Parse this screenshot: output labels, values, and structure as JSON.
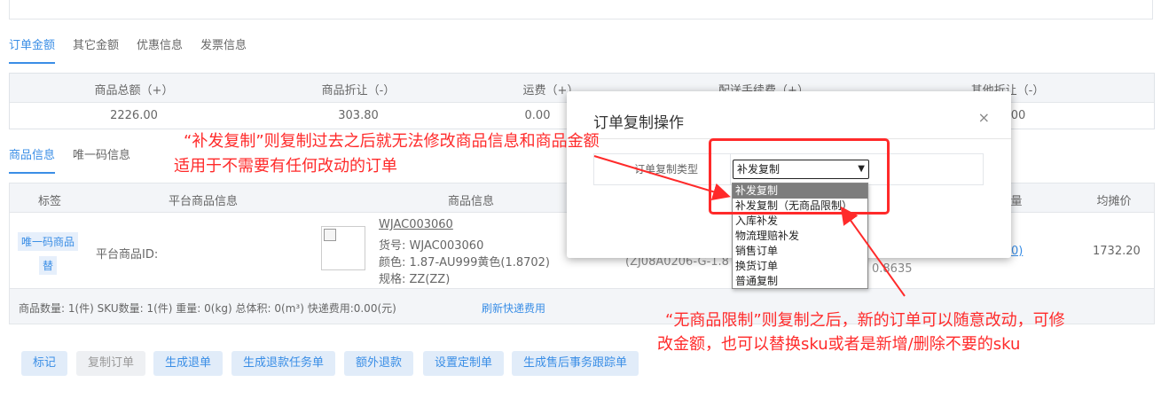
{
  "tabs_amount": [
    "订单金额",
    "其它金额",
    "优惠信息",
    "发票信息"
  ],
  "summary": {
    "headers": [
      "商品总额（+）",
      "商品折让（-）",
      "运费（+）",
      "配送手续费（+）",
      "其他折让（-）"
    ],
    "values": [
      "2226.00",
      "303.80",
      "0.00",
      "",
      ".00"
    ]
  },
  "tabs_goods": [
    "商品信息",
    "唯一码信息"
  ],
  "goods_table": {
    "headers": [
      "标签",
      "平台商品信息",
      "商品信息",
      "量",
      "均摊价"
    ],
    "row": {
      "tag1": "唯一码商品",
      "tag2": "替",
      "platform_id_label": "平台商品ID:",
      "sku_link": "WJAC003060",
      "item_no": "货号:   WJAC003060",
      "color": "颜色:   1.87-AU999黄色(1.8702)",
      "spec": "规格:   ZZ(ZZ)",
      "code_partial": "(ZJ08A0206-G-1.8",
      "value_partial": "0.8635",
      "link_partial": "/0/0)",
      "avg_price": "1732.20"
    }
  },
  "footer": {
    "stats": "商品数量: 1(件)  SKU数量: 1(件)  重量: 0(kg)  总体积: 0(m³)  快递费用:0.00(元)",
    "refresh_link": "刷新快递费用"
  },
  "buttons": [
    "标记",
    "复制订单",
    "生成退单",
    "生成退款任务单",
    "额外退款",
    "设置定制单",
    "生成售后事务跟踪单"
  ],
  "modal": {
    "title": "订单复制操作",
    "close": "×",
    "label": "订单复制类型",
    "selected": "补发复制",
    "options": [
      "补发复制",
      "补发复制（无商品限制）",
      "入库补发",
      "物流理赔补发",
      "销售订单",
      "换货订单",
      "普通复制"
    ]
  },
  "annotations": {
    "top_line1": "“补发复制”则复制过去之后就无法修改商品信息和商品金额",
    "top_line2": "适用于不需要有任何改动的订单",
    "bottom_line1": "“无商品限制”则复制之后，新的订单可以随意改动，可修",
    "bottom_line2": "改金额，也可以替换sku或者是新增/删除不要的sku"
  },
  "colors": {
    "accent": "#3a8ee6",
    "annotation_red": "#ff2a2a"
  }
}
